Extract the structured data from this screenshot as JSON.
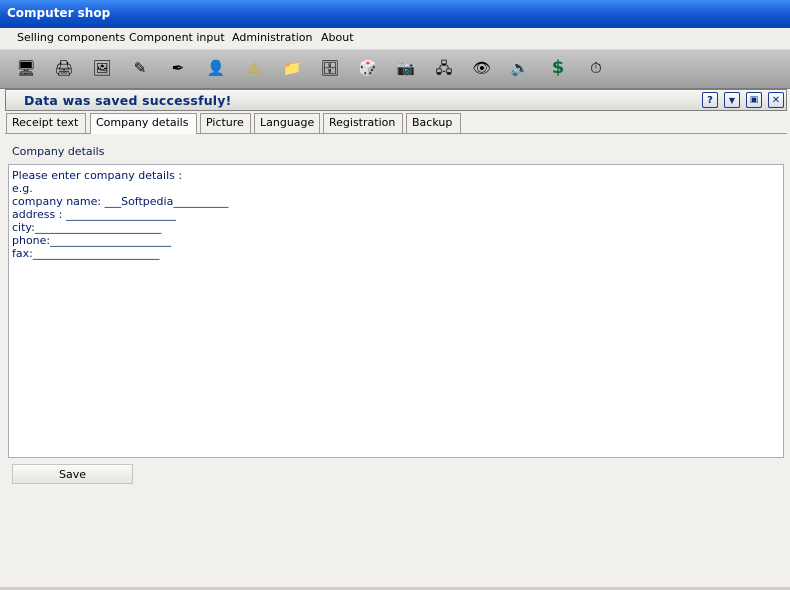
{
  "window": {
    "title": "Computer shop"
  },
  "menu": [
    {
      "label": "Selling components"
    },
    {
      "label": "Component input"
    },
    {
      "label": "Administration"
    },
    {
      "label": "About"
    }
  ],
  "toolbar": [
    {
      "icon": "computer-icon",
      "glyph": "🖥"
    },
    {
      "icon": "printer-icon",
      "glyph": "🖨"
    },
    {
      "icon": "image-icon",
      "glyph": "🖼"
    },
    {
      "icon": "edit-icon",
      "glyph": "✎"
    },
    {
      "icon": "pen-icon",
      "glyph": "✒"
    },
    {
      "icon": "user-icon",
      "glyph": "👤"
    },
    {
      "icon": "warning-icon",
      "glyph": "⚠"
    },
    {
      "icon": "folder-icon",
      "glyph": "📁"
    },
    {
      "icon": "tower-icon",
      "glyph": "🗄"
    },
    {
      "icon": "cube-icon",
      "glyph": "🎲"
    },
    {
      "icon": "webcam-icon",
      "glyph": "📷"
    },
    {
      "icon": "network-icon",
      "glyph": "🖧"
    },
    {
      "icon": "eye-icon",
      "glyph": "👁"
    },
    {
      "icon": "speaker-icon",
      "glyph": "🔊"
    },
    {
      "icon": "dollar-icon",
      "glyph": "$"
    },
    {
      "icon": "clock-icon",
      "glyph": "⏱"
    }
  ],
  "status": {
    "message": "Data was saved successfuly!",
    "help": "?",
    "dropdown": "▼",
    "restore": "▣",
    "close": "✕"
  },
  "tabs": [
    {
      "label": "Receipt text"
    },
    {
      "label": "Company details",
      "active": true
    },
    {
      "label": "Picture"
    },
    {
      "label": "Language"
    },
    {
      "label": "Registration"
    },
    {
      "label": "Backup"
    }
  ],
  "content": {
    "section_title": "Company details",
    "lines": [
      "Please enter company details :",
      "e.g.",
      "company name: ___Softpedia__________",
      "address : ____________________",
      "city:_______________________",
      "phone:______________________",
      "fax:_______________________"
    ]
  },
  "save_label": "Save",
  "colors": {
    "titlebar": "#0b4fc7",
    "status_text": "#0b2e7a",
    "text": "#001a66"
  }
}
